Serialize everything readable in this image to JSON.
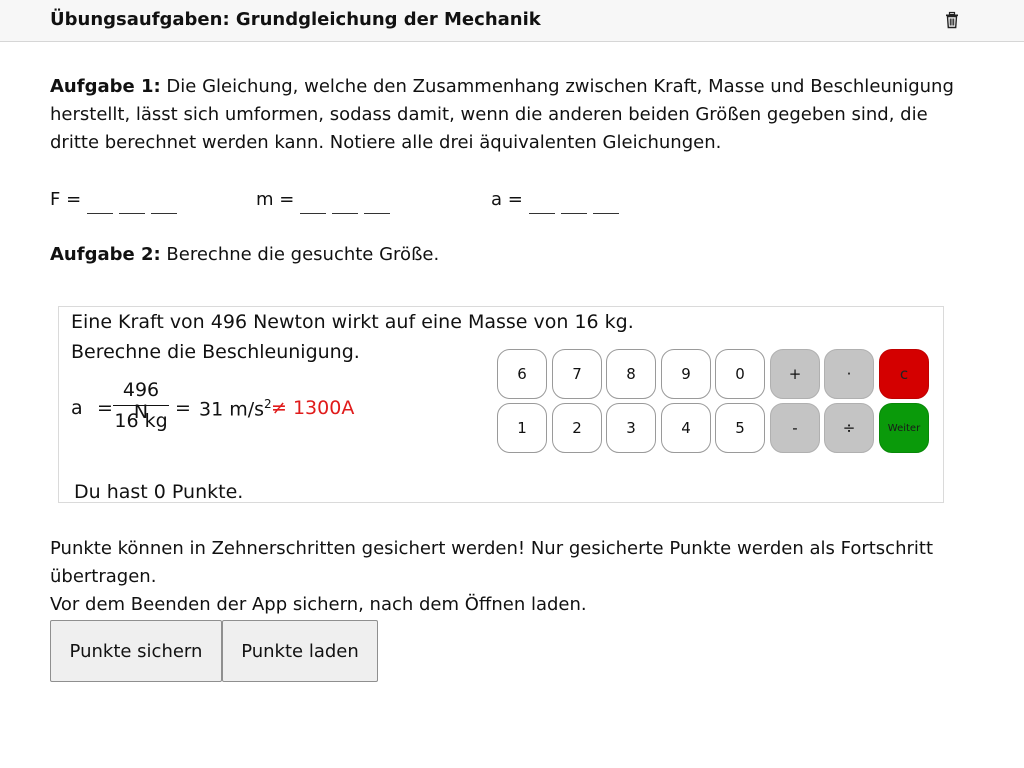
{
  "header": {
    "title": "Übungsaufgaben: Grundgleichung der Mechanik",
    "delete_icon": "trash-icon"
  },
  "task1": {
    "label": "Aufgabe 1:",
    "text": " Die Gleichung, welche den Zusammenhang zwischen Kraft, Masse und Beschleunigung herstellt, lässt sich umformen, sodass damit, wenn die anderen beiden Größen gegeben sind, die dritte berechnet werden kann. Notiere alle drei äquivalenten Gleichungen.",
    "equations": [
      {
        "lhs": "F ="
      },
      {
        "lhs": "m ="
      },
      {
        "lhs": "a ="
      }
    ]
  },
  "task2": {
    "label": "Aufgabe 2:",
    "text": " Berechne die gesuchte Größe."
  },
  "applet": {
    "line1": "Eine Kraft von 496 Newton wirkt auf eine Masse von 16 kg.",
    "line2": "Berechne die Beschleunigung.",
    "formula": {
      "var": "a",
      "eq": "=",
      "numerator": "496 N",
      "denominator": "16 kg",
      "eq2": "=",
      "result_value": "31 m/s",
      "result_exp": "2",
      "wrong_answer": "≠ 1300A"
    },
    "keypad": {
      "row1": [
        "6",
        "7",
        "8",
        "9",
        "0",
        "+",
        "·",
        "c"
      ],
      "row2": [
        "1",
        "2",
        "3",
        "4",
        "5",
        "-",
        "÷",
        "Weiter"
      ]
    },
    "score": "Du hast 0 Punkte."
  },
  "info": {
    "line1": "Punkte können in Zehnerschritten gesichert werden! Nur gesicherte Punkte werden als Fortschritt übertragen.",
    "line2": "Vor dem Beenden der App sichern, nach dem Öffnen laden."
  },
  "buttons": {
    "save": "Punkte sichern",
    "load": "Punkte laden"
  }
}
